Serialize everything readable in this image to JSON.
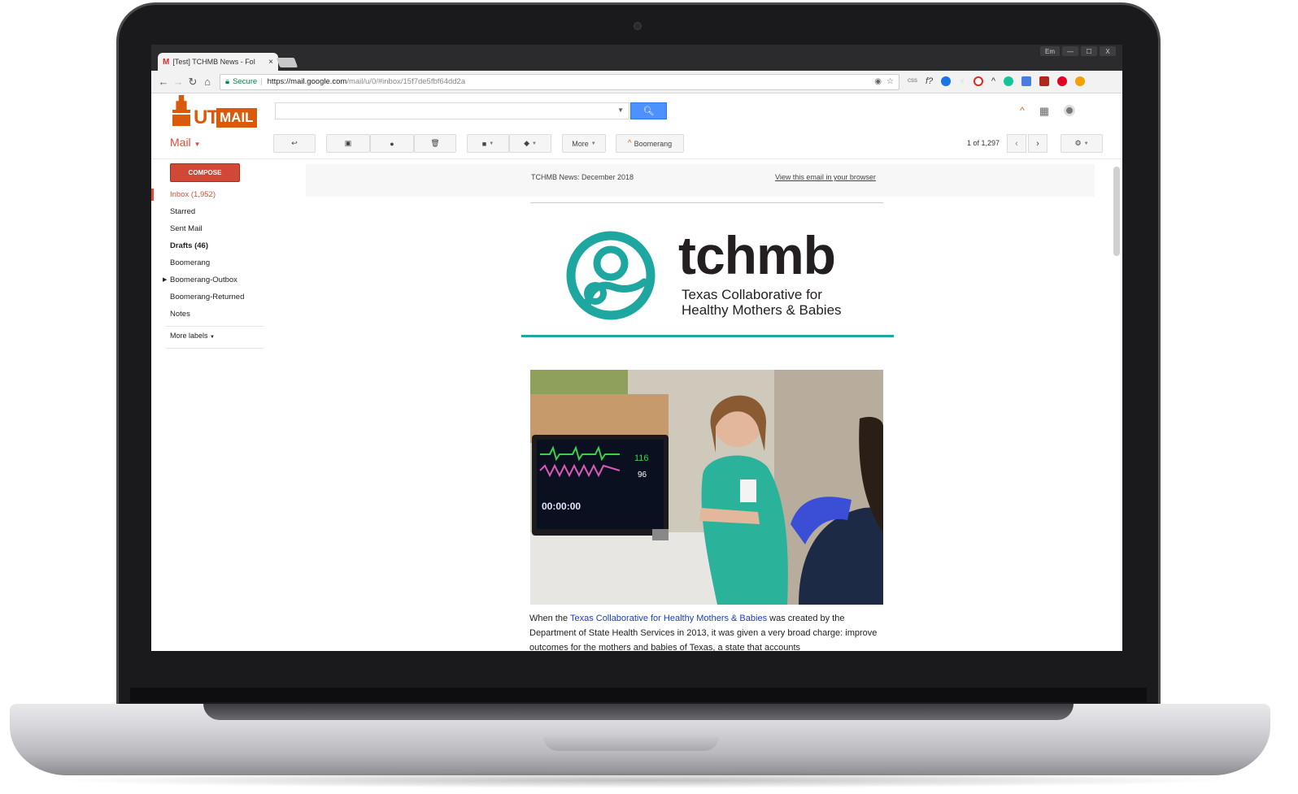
{
  "browser": {
    "tab_title": "[Test] TCHMB News - Fol",
    "tab_close": "×",
    "window_user": "Em",
    "window_min": "—",
    "window_max": "☐",
    "window_close": "X",
    "secure_label": "Secure",
    "url_host": "https://mail.google.com",
    "url_path": "/mail/u/0/#inbox/15f7de5fbf64dd2a"
  },
  "gmail": {
    "logo_ut": "UT",
    "logo_mail": "MAIL",
    "mail_label": "Mail",
    "toolbar": {
      "more_label": "More",
      "boomerang_label": "Boomerang"
    },
    "pager_text": "1 of 1,297",
    "compose_label": "COMPOSE",
    "nav_items": [
      {
        "label": "Inbox (1,952)"
      },
      {
        "label": "Starred"
      },
      {
        "label": "Sent Mail"
      },
      {
        "label": "Drafts (46)"
      },
      {
        "label": "Boomerang"
      },
      {
        "label": "Boomerang-Outbox"
      },
      {
        "label": "Boomerang-Returned"
      },
      {
        "label": "Notes"
      }
    ],
    "more_labels": "More labels"
  },
  "email": {
    "preheader": "TCHMB News: December 2018",
    "view_in_browser": "View this email in your browser",
    "logo_wordmark": "tchmb",
    "logo_tagline_1": "Texas Collaborative for",
    "logo_tagline_2": "Healthy Mothers & Babies",
    "monitor_reading_1": "116",
    "monitor_reading_2": "96",
    "monitor_timer": "00:00:00",
    "body_prefix": "When the ",
    "body_link": "Texas Collaborative for Healthy Mothers & Babies",
    "body_suffix": " was created by the Department of State Health Services in 2013, it was given a very broad charge: improve outcomes for the mothers and babies of Texas, a state that accounts"
  },
  "colors": {
    "gmail_red": "#dd4b39",
    "search_blue": "#4d90fe",
    "ut_orange": "#d85a0a",
    "tchmb_teal": "#1ea7a0",
    "link_blue": "#1a3fb5"
  },
  "icons": [
    "back-arrow-icon",
    "forward-arrow-icon",
    "reload-icon",
    "home-icon",
    "lock-icon",
    "eye-icon",
    "star-icon",
    "search-icon",
    "apps-grid-icon",
    "account-icon",
    "reply-icon",
    "archive-icon",
    "report-spam-icon",
    "delete-icon",
    "folder-icon",
    "label-icon",
    "settings-gear-icon",
    "chevron-left-icon",
    "chevron-right-icon"
  ]
}
